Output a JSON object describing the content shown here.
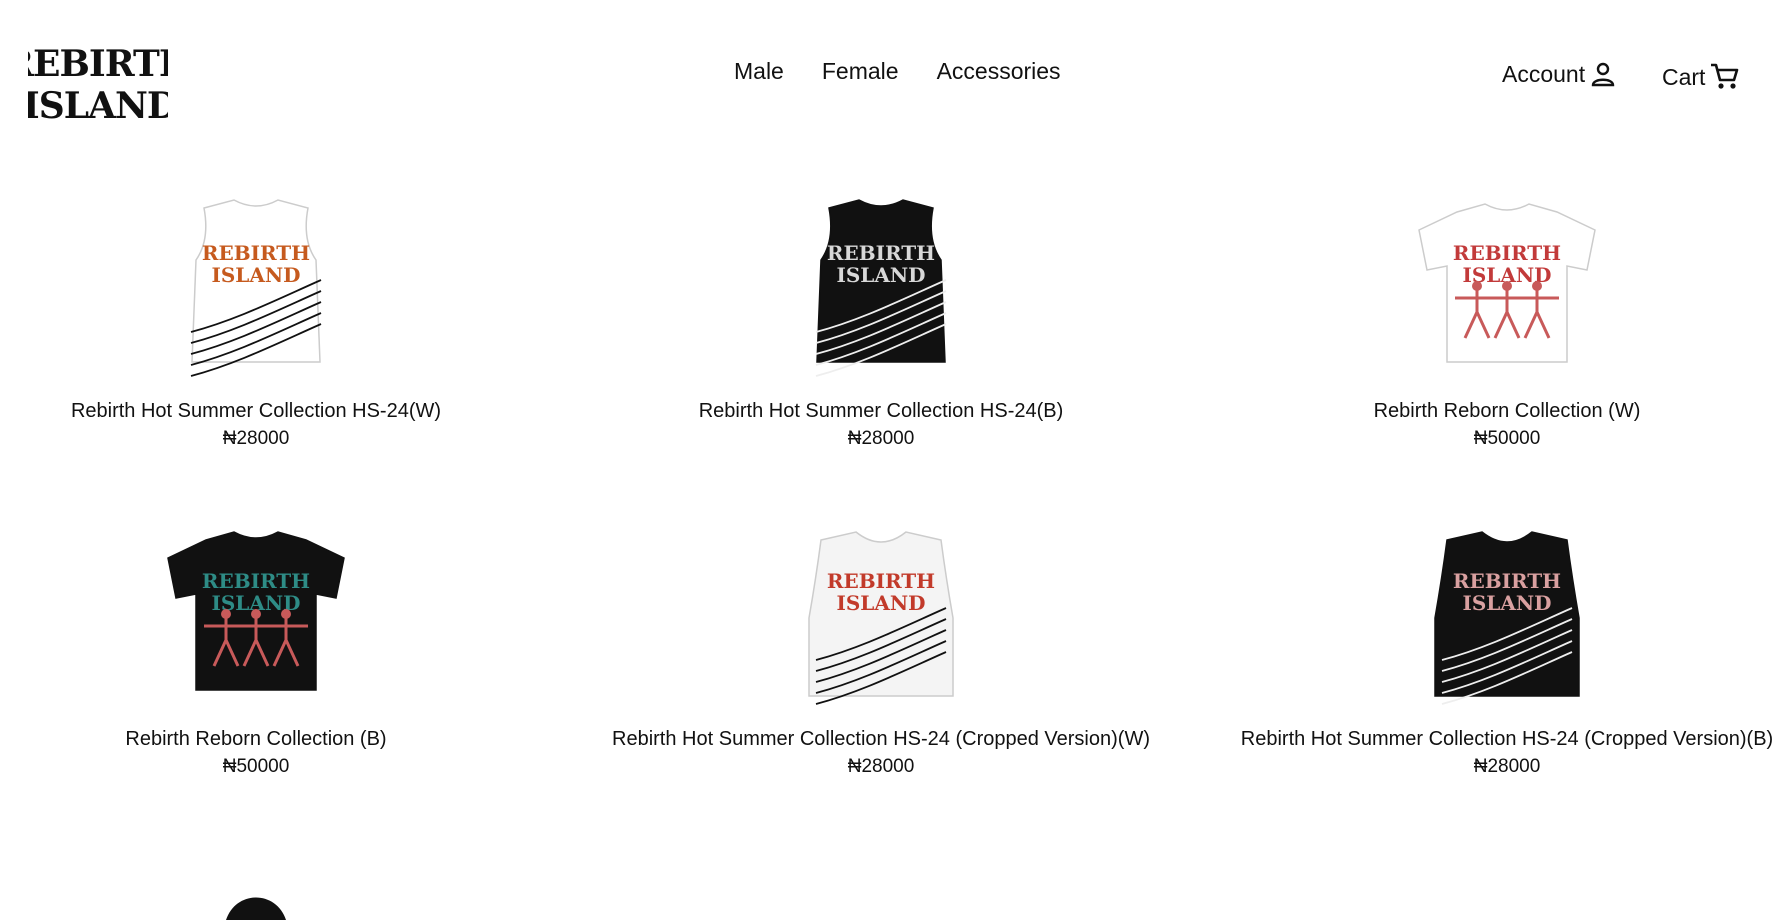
{
  "brand": {
    "logo_line1": "REBIRTH",
    "logo_line2": "ISLAND"
  },
  "nav": {
    "items": [
      "Male",
      "Female",
      "Accessories"
    ]
  },
  "header_actions": {
    "account_label": "Account",
    "account_icon": "person-icon",
    "cart_label": "Cart",
    "cart_icon": "cart-icon"
  },
  "products": [
    {
      "title": "Rebirth Hot Summer Collection HS-24(W)",
      "price": "₦28000",
      "shirt": "sleeveless",
      "color": "#ffffff",
      "print": "#c65a1e"
    },
    {
      "title": "Rebirth Hot Summer Collection HS-24(B)",
      "price": "₦28000",
      "shirt": "sleeveless",
      "color": "#111111",
      "print": "#d8d8d8"
    },
    {
      "title": "Rebirth Reborn Collection (W)",
      "price": "₦50000",
      "shirt": "tee",
      "color": "#ffffff",
      "print": "#c23a3a"
    },
    {
      "title": "Rebirth Reborn Collection (B)",
      "price": "₦50000",
      "shirt": "tee",
      "color": "#111111",
      "print": "#2e8c86"
    },
    {
      "title": "Rebirth Hot Summer Collection HS-24 (Cropped Version)(W)",
      "price": "₦28000",
      "shirt": "cropped",
      "color": "#f4f4f4",
      "print": "#c23a2a"
    },
    {
      "title": "Rebirth Hot Summer Collection HS-24 (Cropped Version)(B)",
      "price": "₦28000",
      "shirt": "cropped",
      "color": "#111111",
      "print": "#d9a0a0"
    }
  ]
}
